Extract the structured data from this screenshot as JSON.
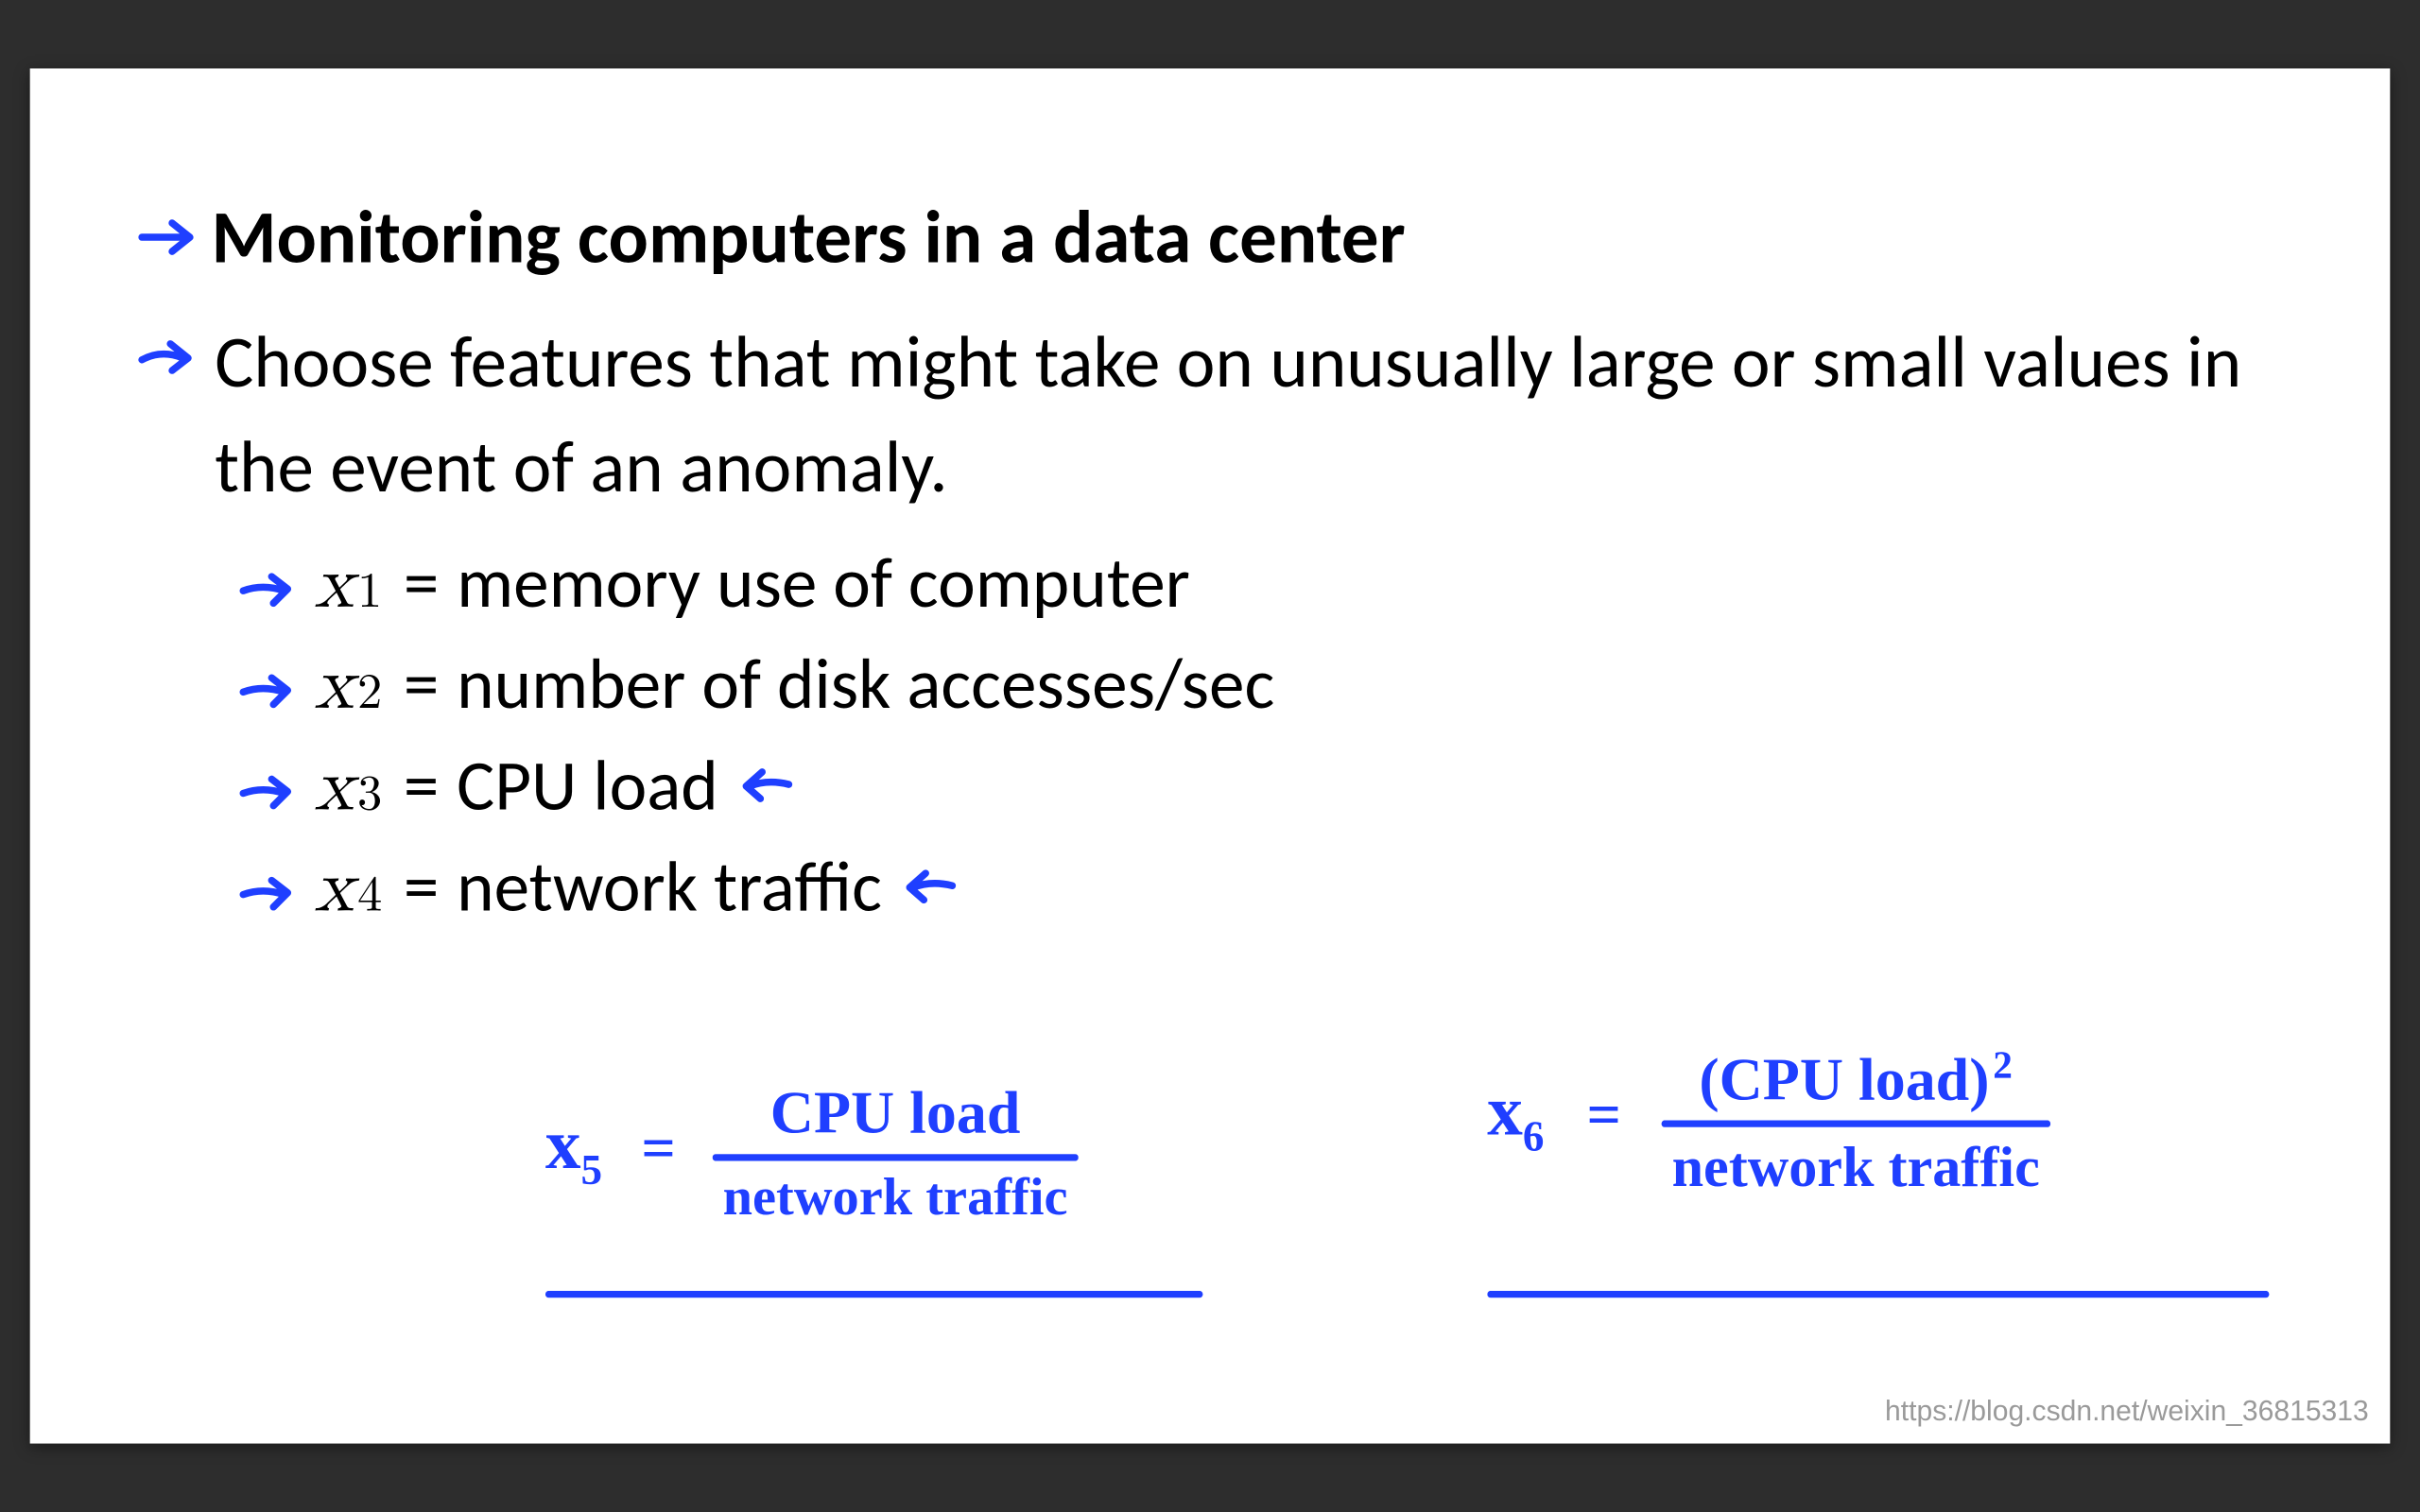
{
  "slide": {
    "title": "Monitoring computers in a data center",
    "subtitle": "Choose features that might take on unusually large or small values in the event of an anomaly.",
    "features": [
      {
        "var": "x",
        "sub": "1",
        "desc": "memory use of computer"
      },
      {
        "var": "x",
        "sub": "2",
        "desc": "number of disk accesses/sec"
      },
      {
        "var": "x",
        "sub": "3",
        "desc": "CPU load"
      },
      {
        "var": "x",
        "sub": "4",
        "desc": "network traffic"
      }
    ],
    "handwritten": {
      "x5": {
        "lhs": "x",
        "lhs_sub": "5",
        "eq": "=",
        "num": "CPU load",
        "den": "network traffic"
      },
      "x6": {
        "lhs": "x",
        "lhs_sub": "6",
        "eq": "=",
        "num": "(CPU load)",
        "num_exp": "2",
        "den": "network traffic"
      }
    },
    "watermark": "https://blog.csdn.net/weixin_36815313"
  },
  "colors": {
    "ink": "#1f3fff",
    "bg": "#2d2d2d",
    "slide": "#ffffff"
  }
}
